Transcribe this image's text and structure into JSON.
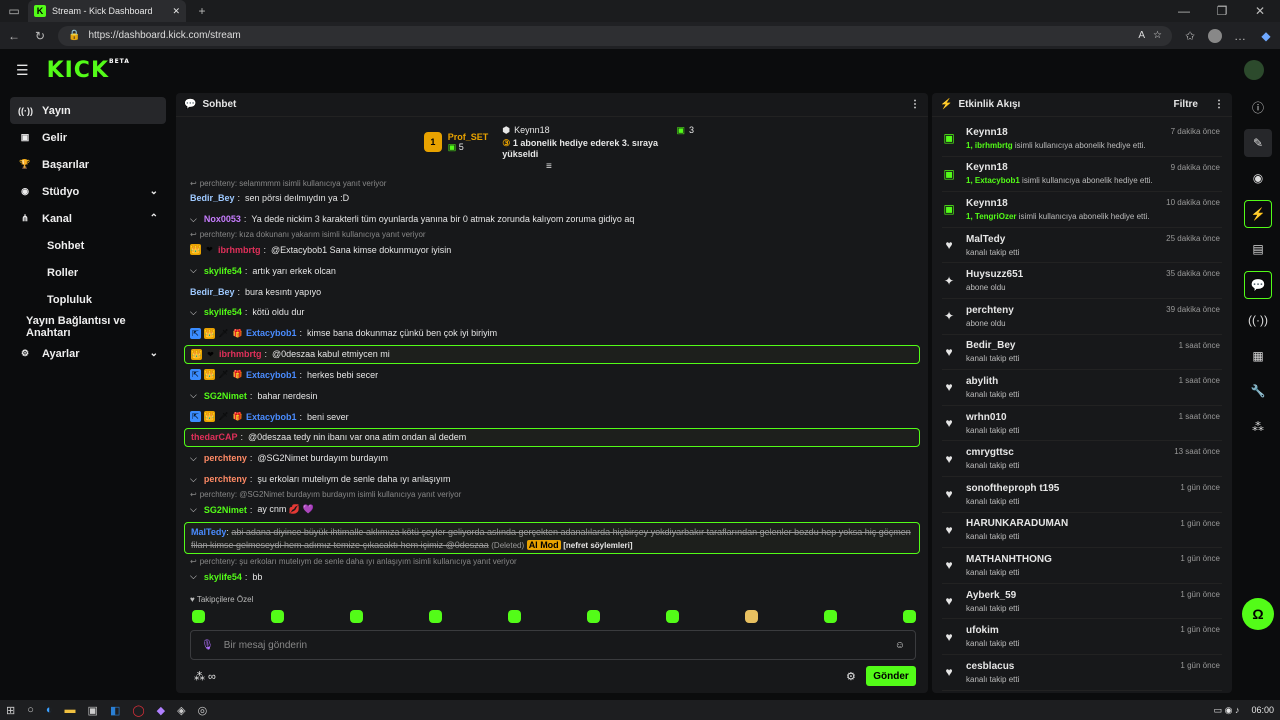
{
  "browser": {
    "tab_title": "Stream - Kick Dashboard",
    "url": "https://dashboard.kick.com/stream",
    "tab_plus": "+",
    "ctrl_min": "—",
    "ctrl_max": "❐",
    "ctrl_close": "✕",
    "back": "←",
    "reload": "↻",
    "read": "A",
    "fav": "☆",
    "collect": "✩",
    "more": "…"
  },
  "header": {
    "brand": "KICK",
    "beta": "BETA",
    "menu": "☰"
  },
  "sidebar": {
    "items": [
      {
        "icon": "((·))",
        "label": "Yayın",
        "active": true
      },
      {
        "icon": "▣",
        "label": "Gelir"
      },
      {
        "icon": "🏆",
        "label": "Başarılar"
      },
      {
        "icon": "◉",
        "label": "Stüdyo",
        "chev": "⌄"
      },
      {
        "icon": "⋔",
        "label": "Kanal",
        "chev": "⌃"
      },
      {
        "label": "Sohbet",
        "sub": true
      },
      {
        "label": "Roller",
        "sub": true
      },
      {
        "label": "Topluluk",
        "sub": true
      },
      {
        "label": "Yayın Bağlantısı ve Anahtarı",
        "sub": true
      },
      {
        "icon": "⚙",
        "label": "Ayarlar",
        "chev": "⌄"
      }
    ]
  },
  "chat": {
    "title": "Sohbet",
    "pinned": {
      "rank": "1",
      "user": "Prof_SET",
      "gifts": "5",
      "gifter": "Keynn18",
      "count": "3",
      "text": "1 abonelik hediye ederek 3. sıraya yükseldi"
    },
    "messages": [
      {
        "reply": "perchteny: selammmm isimli kullanıcıya yanıt veriyor"
      },
      {
        "user": "Bedir_Bey",
        "color": "#9ec9ff",
        "text": "sen pörsi deılmıydın ya :D"
      },
      {
        "chev": true,
        "user": "Nox0053",
        "color": "#c77dff",
        "text": "Ya dede nickim 3 karakterli tüm oyunlarda yanına bir 0 atmak zorunda kalıyom zoruma gidiyo aq"
      },
      {
        "reply": "perchteny: kıza dokunanı yakarım isimli kullanıcıya yanıt veriyor"
      },
      {
        "badges": [
          "👑",
          "❤"
        ],
        "user": "ibrhmbrtg",
        "color": "#e0305a",
        "text": "@Extacybob1 Sana kimse dokunmuyor iyisin"
      },
      {
        "chev": true,
        "user": "skylife54",
        "color": "#53fc18",
        "text": "artık yarı erkek olcan"
      },
      {
        "user": "Bedir_Bey",
        "color": "#9ec9ff",
        "text": "bura kesıntı yapıyo"
      },
      {
        "chev": true,
        "user": "skylife54",
        "color": "#53fc18",
        "text": "kötü oldu dur"
      },
      {
        "badges": [
          "⇱",
          "👑",
          "🗡",
          "🎁"
        ],
        "user": "Extacybob1",
        "color": "#4a8cff",
        "text": "kimse bana dokunmaz çünkü ben çok iyi biriyim"
      },
      {
        "hl": true,
        "badges": [
          "👑",
          "❤"
        ],
        "user": "ibrhmbrtg",
        "color": "#e0305a",
        "text": "@0deszaa kabul etmiycen mi"
      },
      {
        "badges": [
          "⇱",
          "👑",
          "🗡",
          "🎁"
        ],
        "user": "Extacybob1",
        "color": "#4a8cff",
        "text": "herkes bebi secer"
      },
      {
        "chev": true,
        "user": "SG2Nimet",
        "color": "#53fc18",
        "text": "bahar nerdesin"
      },
      {
        "badges": [
          "⇱",
          "👑",
          "🗡",
          "🎁"
        ],
        "user": "Extacybob1",
        "color": "#4a8cff",
        "text": "beni sever"
      },
      {
        "hl": true,
        "user": "thedarCAP",
        "color": "#e0305a",
        "text": "@0deszaa tedy nin ibanı var ona atim ondan al dedem"
      },
      {
        "chev": true,
        "user": "perchteny",
        "color": "#ff8a65",
        "text": "@SG2Nimet burdayım burdayım"
      },
      {
        "chev": true,
        "user": "perchteny",
        "color": "#ff8a65",
        "text": "şu erkoları mutelıym de senle daha ıyı anlaşıyım"
      },
      {
        "reply": "perchteny: @SG2Nimet burdayım burdayım isimli kullanıcıya yanıt veriyor"
      },
      {
        "chev": true,
        "user": "SG2Nimet",
        "color": "#53fc18",
        "text": "ay cnm 💋 💜"
      },
      {
        "deleted": true,
        "user": "MalTedy",
        "color": "#4a8cff",
        "text": "abi adana diyince büyük ihtimalle aklımıza kötü şeyler geliyorda aslında gerçekten adanalılarda hiçbirşey yokdiyarbakır taraflarından gelenler bozdu hep yoksa hiç göçmen filan kimse gelmeseydi hem adımız temize çıkacaktı hem içimiz @0deszaa",
        "text2": "(Deleted)",
        "aimod": "AI Mod",
        "reason": "[nefret söylemleri]"
      },
      {
        "reply": "perchteny: şu erkoları mutelıym de senle daha ıyı anlaşıyım isimli kullanıcıya yanıt veriyor"
      },
      {
        "chev": true,
        "user": "skylife54",
        "color": "#53fc18",
        "text": "bb"
      }
    ],
    "followers_label": "Takipçilere Özel",
    "placeholder": "Bir mesaj gönderin",
    "send": "Gönder"
  },
  "events": {
    "title": "Etkinlik Akışı",
    "filter": "Filtre",
    "items": [
      {
        "icon": "gift",
        "name": "Keynn18",
        "who": "1, ibrhmbrtg",
        "desc": "isimli kullanıcıya abonelik hediye etti.",
        "time": "7 dakika önce"
      },
      {
        "icon": "gift",
        "name": "Keynn18",
        "who": "1, Extacybob1",
        "desc": "isimli kullanıcıya abonelik hediye etti.",
        "time": "9 dakika önce"
      },
      {
        "icon": "gift",
        "name": "Keynn18",
        "who": "1, TengriOzer",
        "desc": "isimli kullanıcıya abonelik hediye etti.",
        "time": "10 dakika önce"
      },
      {
        "icon": "heart",
        "name": "MalTedy",
        "desc": "kanalı takip etti",
        "time": "25 dakika önce"
      },
      {
        "icon": "star",
        "name": "Huysuzz651",
        "desc": "abone oldu",
        "time": "35 dakika önce"
      },
      {
        "icon": "star",
        "name": "perchteny",
        "desc": "abone oldu",
        "time": "39 dakika önce"
      },
      {
        "icon": "heart",
        "name": "Bedir_Bey",
        "desc": "kanalı takip etti",
        "time": "1 saat önce"
      },
      {
        "icon": "heart",
        "name": "abylith",
        "desc": "kanalı takip etti",
        "time": "1 saat önce"
      },
      {
        "icon": "heart",
        "name": "wrhn010",
        "desc": "kanalı takip etti",
        "time": "1 saat önce"
      },
      {
        "icon": "heart",
        "name": "cmrygttsc",
        "desc": "kanalı takip etti",
        "time": "13 saat önce"
      },
      {
        "icon": "heart",
        "name": "sonoftheproph t195",
        "desc": "kanalı takip etti",
        "time": "1 gün önce"
      },
      {
        "icon": "heart",
        "name": "HARUNKARADUMAN",
        "desc": "kanalı takip etti",
        "time": "1 gün önce"
      },
      {
        "icon": "heart",
        "name": "MATHANHTHONG",
        "desc": "kanalı takip etti",
        "time": "1 gün önce"
      },
      {
        "icon": "heart",
        "name": "Ayberk_59",
        "desc": "kanalı takip etti",
        "time": "1 gün önce"
      },
      {
        "icon": "heart",
        "name": "ufokim",
        "desc": "kanalı takip etti",
        "time": "1 gün önce"
      },
      {
        "icon": "heart",
        "name": "cesblacus",
        "desc": "kanalı takip etti",
        "time": "1 gün önce"
      }
    ]
  },
  "taskbar": {
    "time": "06:00"
  }
}
